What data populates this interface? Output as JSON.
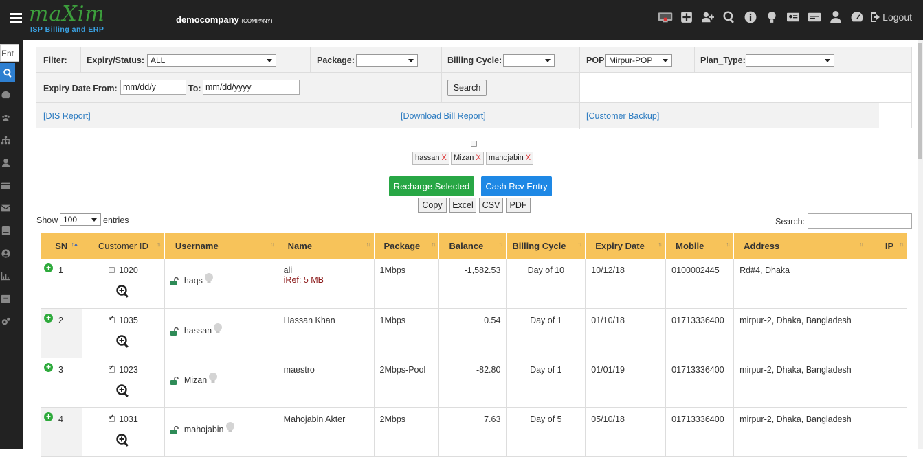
{
  "header": {
    "logo_main": "maXim",
    "logo_sub": "ISP Billing and ERP",
    "company": "democompany",
    "company_tag": "(COMPANY)",
    "logout": "Logout",
    "icons": [
      "monitor-icon",
      "plus-box-icon",
      "add-user-icon",
      "search-icon",
      "info-icon",
      "bulb-icon",
      "id-card-icon",
      "billing-icon",
      "user-icon",
      "dashboard-icon",
      "logout-icon"
    ]
  },
  "sidebar": {
    "search_value": "Ent",
    "items": [
      "dashboard-icon",
      "users-icon",
      "sitemap-icon",
      "user-icon",
      "card-icon",
      "mail-icon",
      "server-icon",
      "profile-icon",
      "chart-icon",
      "box-icon",
      "settings-icon"
    ]
  },
  "filter": {
    "label": "Filter:",
    "expiry_status_label": "Expiry/Status:",
    "expiry_status_value": "ALL",
    "package_label": "Package:",
    "package_value": "",
    "billing_cycle_label": "Billing Cycle:",
    "billing_cycle_value": "",
    "pop_label": "POP",
    "pop_value": "Mirpur-POP",
    "plan_type_label": "Plan_Type:",
    "plan_type_value": "",
    "expiry_from_label": "Expiry Date From:",
    "expiry_from_value": "mm/dd/y",
    "to_label": "To:",
    "to_value": "mm/dd/yyyy",
    "search_button": "Search",
    "links": [
      "[DIS Report]",
      "[Download Bill Report]",
      "[Customer Backup]"
    ]
  },
  "selected_chips": [
    "hassan",
    "Mizan",
    "mahojabin"
  ],
  "chip_remove": "X",
  "actions": {
    "recharge": "Recharge Selected",
    "cash": "Cash Rcv Entry",
    "exports": [
      "Copy",
      "Excel",
      "CSV",
      "PDF"
    ]
  },
  "table_controls": {
    "show_label": "Show",
    "entries_value": "100",
    "entries_label": "entries",
    "search_label": "Search:",
    "search_value": ""
  },
  "table": {
    "columns": [
      "SN",
      "Customer ID",
      "Username",
      "Name",
      "Package",
      "Balance",
      "Billing Cycle",
      "Expiry Date",
      "Mobile",
      "Address",
      "IP"
    ],
    "rows": [
      {
        "sn": "1",
        "checked": false,
        "cid": "1020",
        "username": "haqs",
        "name": "ali",
        "iref": "iRef: 5 MB",
        "package": "1Mbps",
        "balance": "-1,582.53",
        "negative": true,
        "cycle": "Day of 10",
        "expiry": "10/12/18",
        "mobile": "0100002445",
        "address": "Rd#4, Dhaka",
        "ip": ""
      },
      {
        "sn": "2",
        "checked": true,
        "cid": "1035",
        "username": "hassan",
        "name": "Hassan Khan",
        "iref": "",
        "package": "1Mbps",
        "balance": "0.54",
        "negative": false,
        "cycle": "Day of 1",
        "expiry": "01/10/18",
        "mobile": "01713336400",
        "address": "mirpur-2, Dhaka, Bangladesh",
        "ip": ""
      },
      {
        "sn": "3",
        "checked": true,
        "cid": "1023",
        "username": "Mizan",
        "name": "maestro",
        "iref": "",
        "package": "2Mbps-Pool",
        "balance": "-82.80",
        "negative": true,
        "cycle": "Day of 1",
        "expiry": "01/01/19",
        "mobile": "01713336400",
        "address": "mirpur-2, Dhaka, Bangladesh",
        "ip": ""
      },
      {
        "sn": "4",
        "checked": true,
        "cid": "1031",
        "username": "mahojabin",
        "name": "Mahojabin Akter",
        "iref": "",
        "package": "2Mbps",
        "balance": "7.63",
        "negative": false,
        "cycle": "Day of 5",
        "expiry": "05/10/18",
        "mobile": "01713336400",
        "address": "mirpur-2, Dhaka, Bangladesh",
        "ip": ""
      }
    ]
  },
  "colors": {
    "header_bg": "#222222",
    "table_header": "#f7c35a",
    "green_button": "#28a745",
    "blue_button": "#1e88e5",
    "negative": "#8b1a1a"
  }
}
